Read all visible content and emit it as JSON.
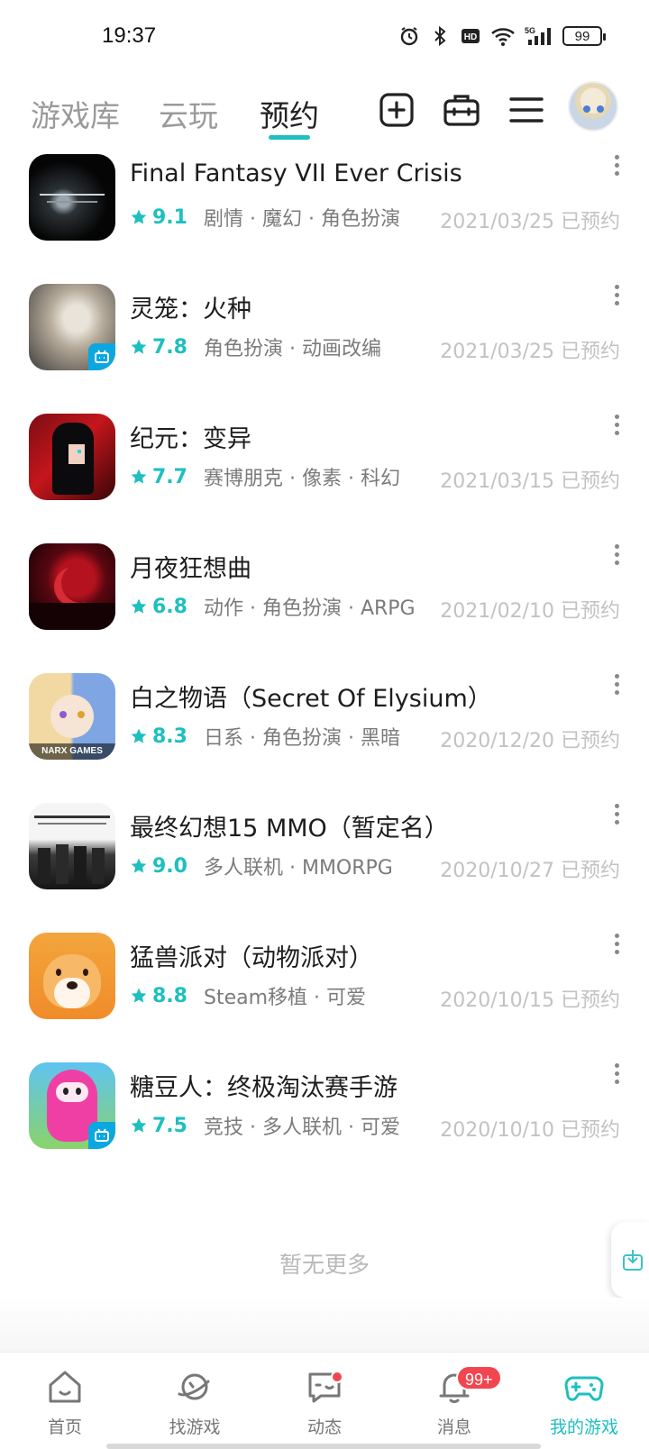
{
  "status_bar": {
    "time": "19:37",
    "battery": "99",
    "network": "5G"
  },
  "top_nav": {
    "tabs": [
      {
        "label": "游戏库",
        "active": false
      },
      {
        "label": "云玩",
        "active": false
      },
      {
        "label": "预约",
        "active": true
      }
    ],
    "icons": [
      "add-square-icon",
      "toolbox-icon",
      "menu-icon"
    ],
    "accent_color": "#1fbfc0"
  },
  "games": [
    {
      "name": "Final Fantasy  VII Ever Crisis",
      "rating": "9.1",
      "tags": "剧情 · 魔幻 · 角色扮演",
      "date": "2021/03/25 已预约",
      "icon": "ff7-icon"
    },
    {
      "name": "灵笼：火种",
      "rating": "7.8",
      "tags": "角色扮演 · 动画改编",
      "date": "2021/03/25 已预约",
      "icon": "linglong-icon",
      "badge": "bilibili-badge-icon"
    },
    {
      "name": "纪元：变异",
      "rating": "7.7",
      "tags": "赛博朋克 · 像素 · 科幻",
      "date": "2021/03/15 已预约",
      "icon": "jiyuan-icon"
    },
    {
      "name": "月夜狂想曲",
      "rating": "6.8",
      "tags": "动作 · 角色扮演 · ARPG",
      "date": "2021/02/10 已预约",
      "icon": "yueye-icon"
    },
    {
      "name": "白之物语（Secret Of Elysium）",
      "rating": "8.3",
      "tags": "日系 · 角色扮演 · 黑暗",
      "date": "2020/12/20 已预约",
      "icon": "baizhi-icon",
      "icon_text": "NARX GAMES"
    },
    {
      "name": "最终幻想15 MMO（暂定名）",
      "rating": "9.0",
      "tags": "多人联机 · MMORPG",
      "date": "2020/10/27 已预约",
      "icon": "ff15-icon"
    },
    {
      "name": "猛兽派对（动物派对）",
      "rating": "8.8",
      "tags": "Steam移植 · 可爱",
      "date": "2020/10/15 已预约",
      "icon": "party-animals-icon"
    },
    {
      "name": "糖豆人：终极淘汰赛手游",
      "rating": "7.5",
      "tags": "竞技 · 多人联机 · 可爱",
      "date": "2020/10/10 已预约",
      "icon": "fall-guys-icon",
      "badge": "bilibili-badge-icon"
    }
  ],
  "footer_text": "暂无更多",
  "bottom_nav": [
    {
      "label": "首页",
      "icon": "home-icon"
    },
    {
      "label": "找游戏",
      "icon": "planet-icon"
    },
    {
      "label": "动态",
      "icon": "chat-icon",
      "dot": true
    },
    {
      "label": "消息",
      "icon": "bell-icon",
      "badge": "99+"
    },
    {
      "label": "我的游戏",
      "icon": "gamepad-icon",
      "active": true
    }
  ]
}
